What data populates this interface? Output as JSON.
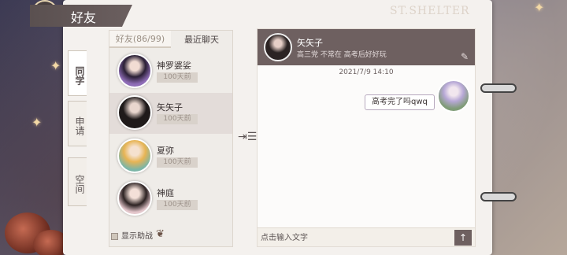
{
  "page": {
    "title": "好友",
    "watermark": "ST.SHELTER"
  },
  "sidebar": {
    "tabs": [
      {
        "label": "同学"
      },
      {
        "label": "申请"
      },
      {
        "label": "空间"
      }
    ]
  },
  "friends": {
    "tabs": [
      {
        "label": "好友(86/99)"
      },
      {
        "label": "最近聊天"
      }
    ],
    "list": [
      {
        "name": "神罗婆娑",
        "time": "100天前"
      },
      {
        "name": "矢矢子",
        "time": "100天前"
      },
      {
        "name": "夏弥",
        "time": "100天前"
      },
      {
        "name": "神庭",
        "time": "100天前"
      }
    ],
    "assist_label": "显示助战"
  },
  "chat": {
    "contact_name": "矢矢子",
    "contact_status": "高三党  不常在  高考后好好玩",
    "timestamp": "2021/7/9  14:10",
    "messages": [
      {
        "text": "高考完了吗qwq"
      }
    ],
    "input_placeholder": "点击输入文字"
  },
  "icons": {
    "emblem": "sword-emblem-icon",
    "star": "star-icon",
    "fold": "collapse-panel-icon",
    "edit": "edit-icon",
    "send": "send-arrow-icon",
    "feather": "feather-icon"
  }
}
